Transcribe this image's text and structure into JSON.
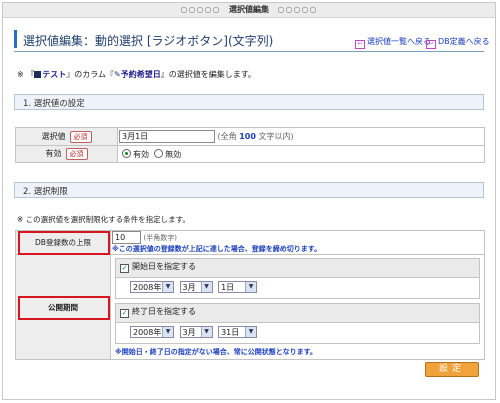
{
  "window": {
    "title": "選択値編集"
  },
  "page": {
    "title": "選択値編集：動的選択 [ラジオボタン](文字列)"
  },
  "links": {
    "list_back": "選択値一覧へ戻る",
    "db_back": "DB定義へ戻る"
  },
  "note": {
    "prefix": "『",
    "db_name": "テスト",
    "mid": "』のカラム『",
    "column_name": "予約希望日",
    "suffix": "』の選択値を編集します。"
  },
  "section1": {
    "title": "1. 選択値の設定"
  },
  "fields": {
    "value_label": "選択値",
    "required": "必須",
    "value": "3月1日",
    "value_hint_prefix": "(全角 ",
    "value_hint_num": "100",
    "value_hint_suffix": " 文字以内)",
    "valid_label": "有効",
    "valid_on": "有効",
    "valid_off": "無効"
  },
  "section2": {
    "title": "2. 選択制限"
  },
  "note2": "※ この選択値を選択制限化する条件を指定します。",
  "limit": {
    "label": "DB登録数の上限",
    "value": "10",
    "hint": "(半角数字)",
    "warn": "※この選択値の登録数が上記に達した場合、登録を締め切ります。"
  },
  "period": {
    "label": "公開期間",
    "start_label": "開始日を指定する",
    "start_year": "2008年",
    "start_month": "3月",
    "start_day": "1日",
    "end_label": "終了日を指定する",
    "end_year": "2008年",
    "end_month": "3月",
    "end_day": "31日",
    "warn": "※開始日・終了日の指定がない場合、常に公開状態となります。"
  },
  "buttons": {
    "set": "設定"
  }
}
